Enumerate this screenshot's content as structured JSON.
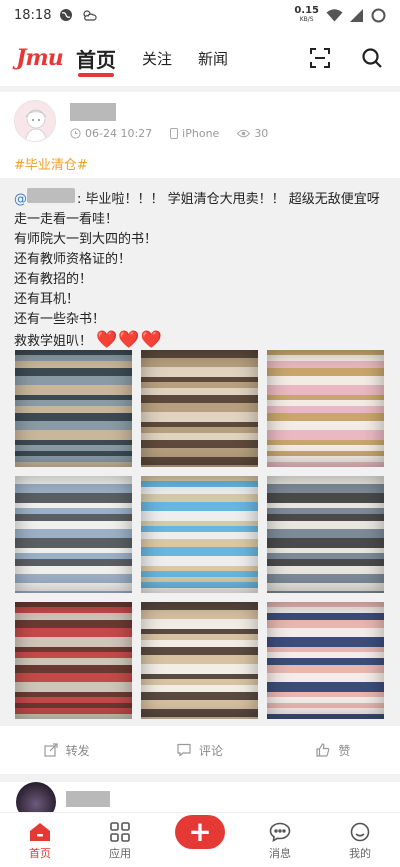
{
  "status_bar": {
    "time": "18:18",
    "speed_value": "0.15",
    "speed_unit": "KB/S"
  },
  "header": {
    "logo": "Jmu",
    "tabs": [
      {
        "label": "首页",
        "active": true
      },
      {
        "label": "关注",
        "active": false
      },
      {
        "label": "新闻",
        "active": false
      }
    ],
    "icons": [
      "scan-icon",
      "search-icon"
    ]
  },
  "post": {
    "date": "06-24 10:27",
    "device": "iPhone",
    "views": "30",
    "topic": "#毕业清仓#",
    "mention_prefix": "@",
    "lines": [
      ": 毕业啦！！！ 学姐清仓大甩卖！！ 超级无敌便宜呀走一走看一看哇！",
      "有师院大一到大四的书！",
      "还有教师资格证的！",
      "还有教招的！",
      "还有耳机！",
      "还有一些杂书！",
      "救救学姐叭！"
    ],
    "hearts": "❤️❤️❤️",
    "photos": [
      {
        "name": "book-stack-photo-1",
        "colors": [
          "#3d4a52",
          "#8a9ba6",
          "#c9b79a"
        ]
      },
      {
        "name": "book-stack-photo-2",
        "colors": [
          "#5e4a3c",
          "#b7a07f",
          "#e0d3c0"
        ]
      },
      {
        "name": "book-covers-photo-3",
        "colors": [
          "#c9a66b",
          "#f3ece4",
          "#e9b8c0"
        ]
      },
      {
        "name": "papers-stack-photo-4",
        "colors": [
          "#f0f0ee",
          "#9cb0c6",
          "#5a5f63"
        ]
      },
      {
        "name": "headphones-box-photo-5",
        "colors": [
          "#d8c9a6",
          "#67b6e0",
          "#eeeeee"
        ]
      },
      {
        "name": "papers-stack-photo-6",
        "colors": [
          "#e9e6e0",
          "#7d8a98",
          "#4a4a4a"
        ]
      },
      {
        "name": "book-pile-photo-7",
        "colors": [
          "#6a3a32",
          "#c44a4a",
          "#cfc6b9"
        ]
      },
      {
        "name": "book-pile-photo-8",
        "colors": [
          "#5a4a40",
          "#d7c2a2",
          "#f2eee6"
        ]
      },
      {
        "name": "exam-book-photo-9",
        "colors": [
          "#e7b7b0",
          "#f4ecea",
          "#3b4d7a"
        ]
      }
    ]
  },
  "actions": [
    {
      "label": "转发",
      "icon": "share-icon"
    },
    {
      "label": "评论",
      "icon": "comment-icon"
    },
    {
      "label": "赞",
      "icon": "thumbs-up-icon"
    }
  ],
  "bottom_nav": [
    {
      "label": "首页",
      "icon": "home-icon",
      "active": true
    },
    {
      "label": "应用",
      "icon": "apps-icon",
      "active": false
    },
    {
      "label": "",
      "icon": "plus-icon",
      "active": false
    },
    {
      "label": "消息",
      "icon": "message-icon",
      "active": false
    },
    {
      "label": "我的",
      "icon": "profile-icon",
      "active": false
    }
  ],
  "colors": {
    "accent": "#e53935",
    "topic": "#f0a027",
    "mention": "#3a80c9"
  }
}
